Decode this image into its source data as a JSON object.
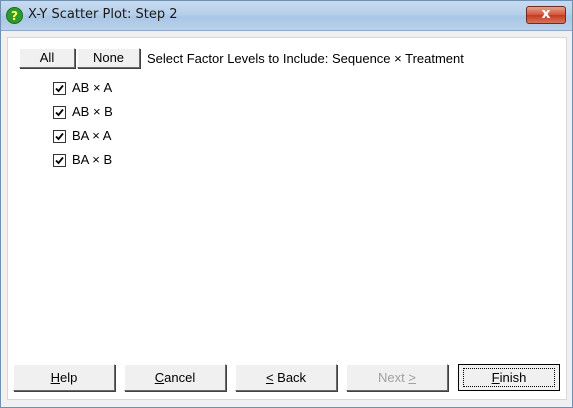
{
  "window": {
    "title": "X-Y Scatter Plot: Step 2",
    "close_label": "x"
  },
  "selection": {
    "all_label": "All",
    "none_label": "None",
    "instruction": "Select Factor Levels to Include: Sequence × Treatment"
  },
  "levels": [
    {
      "label": "AB × A",
      "checked": true
    },
    {
      "label": "AB × B",
      "checked": true
    },
    {
      "label": "BA × A",
      "checked": true
    },
    {
      "label": "BA × B",
      "checked": true
    }
  ],
  "footer": {
    "help": {
      "mnemonic": "H",
      "rest": "elp"
    },
    "cancel": {
      "mnemonic": "C",
      "rest": "ancel"
    },
    "back": {
      "mnemonic": "<",
      "rest": " Back"
    },
    "next": {
      "rest": "Next ",
      "mnemonic": ">"
    },
    "finish": {
      "mnemonic": "F",
      "rest": "inish"
    }
  },
  "colors": {
    "titlebar": "#b9d1ec",
    "close_button": "#d3533a",
    "help_icon": "#2e9a2e"
  },
  "icons": {
    "title": "help-question-icon",
    "close": "close-icon",
    "checkbox": "checkmark-icon"
  }
}
